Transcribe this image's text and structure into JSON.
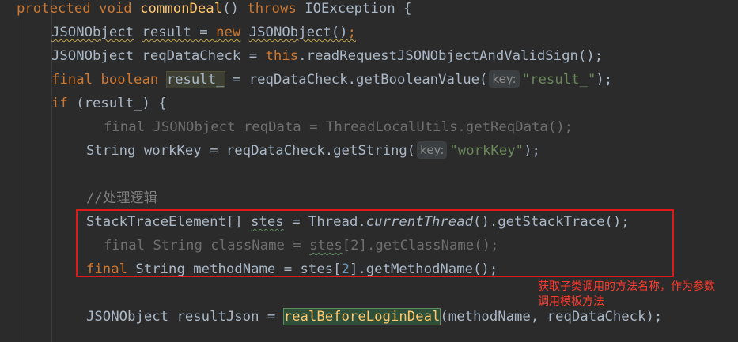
{
  "code": {
    "line1": {
      "protected": "protected",
      "void": "void",
      "method": "commonDeal",
      "parens": "()",
      "throws": "throws",
      "exception": "IOException {"
    },
    "line2": {
      "type": "JSONObject",
      "var": "result",
      "eq": " = ",
      "new": "new",
      "ctor": "JSONObject()",
      "semi": ";"
    },
    "line3": {
      "type": "JSONObject reqDataCheck = ",
      "this": "this",
      "call": ".readRequestJSONObjectAndValidSign();"
    },
    "line4": {
      "final": "final",
      "boolean": "boolean",
      "var": "result_",
      "call": " = reqDataCheck.getBooleanValue(",
      "hint": "key:",
      "str": "\"result_\"",
      "end": ");"
    },
    "line5": {
      "if": "if",
      "rest": " (result_) {"
    },
    "line6": {
      "text": "final JSONObject reqData = ThreadLocalUtils.getReqData();"
    },
    "line7": {
      "type": "String workKey = reqDataCheck.getString(",
      "hint": "key:",
      "str": "\"workKey\"",
      "end": ");"
    },
    "line9": {
      "comment": "//处理逻辑"
    },
    "line10": {
      "type": "StackTraceElement[] ",
      "var": "stes",
      "eq": " = Thread.",
      "method": "currentThread",
      "end": "().getStackTrace();"
    },
    "line11": {
      "final": "final String className = ",
      "var": "stes",
      "mid": "[2].getClassName();"
    },
    "line12": {
      "final": "final",
      "mid": " String methodName = stes[",
      "num": "2",
      "end": "].getMethodName();"
    },
    "line14": {
      "start": "JSONObject resultJson = ",
      "method": "realBeforeLoginDeal",
      "end": "(methodName, reqDataCheck);"
    }
  },
  "annotation": {
    "line1": "获取子类调用的方法名称，作为参数",
    "line2": "调用模板方法"
  },
  "colors": {
    "background": "#2b2b2b",
    "keyword": "#cc7832",
    "method": "#ffc66d",
    "string": "#6a8759",
    "number": "#6897bb",
    "text": "#a9b7c6",
    "comment": "#808080",
    "box": "#e01a1a",
    "annotation": "#ff3b2f"
  }
}
